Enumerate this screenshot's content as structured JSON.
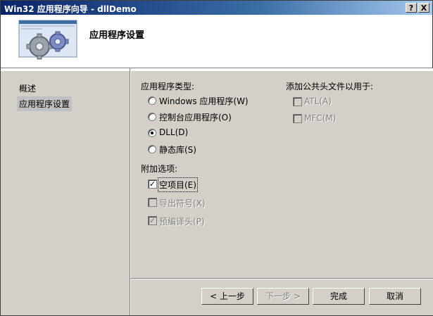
{
  "window": {
    "title": "Win32 应用程序向导 - dllDemo",
    "help_button": "?",
    "close_button": "X"
  },
  "header": {
    "title": "应用程序设置"
  },
  "nav": {
    "items": [
      {
        "label": "概述"
      },
      {
        "label": "应用程序设置"
      }
    ]
  },
  "app_type": {
    "label": "应用程序类型:",
    "options": [
      {
        "label": "Windows 应用程序(W)",
        "selected": false
      },
      {
        "label": "控制台应用程序(O)",
        "selected": false
      },
      {
        "label": "DLL(D)",
        "selected": true
      },
      {
        "label": "静态库(S)",
        "selected": false
      }
    ]
  },
  "extra": {
    "label": "附加选项:",
    "options": [
      {
        "label": "空项目(E)",
        "checked": true,
        "enabled": true
      },
      {
        "label": "导出符号(X)",
        "checked": false,
        "enabled": false
      },
      {
        "label": "预编译头(P)",
        "checked": true,
        "enabled": false
      }
    ]
  },
  "headers": {
    "label": "添加公共头文件以用于:",
    "options": [
      {
        "label": "ATL(A)",
        "checked": false,
        "enabled": false
      },
      {
        "label": "MFC(M)",
        "checked": false,
        "enabled": false
      }
    ]
  },
  "buttons": {
    "prev": "< 上一步",
    "next": "下一步 >",
    "finish": "完成",
    "cancel": "取消"
  }
}
